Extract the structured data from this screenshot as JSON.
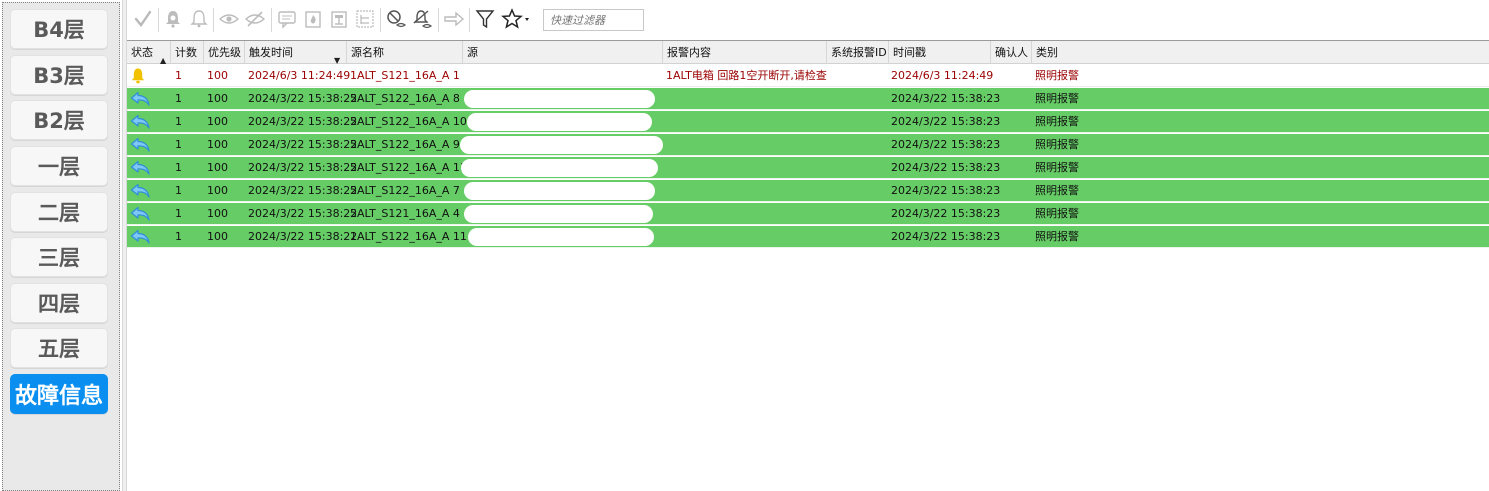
{
  "sidebar": {
    "items": [
      {
        "label": "B4层",
        "active": false
      },
      {
        "label": "B3层",
        "active": false
      },
      {
        "label": "B2层",
        "active": false
      },
      {
        "label": "一层",
        "active": false
      },
      {
        "label": "二层",
        "active": false
      },
      {
        "label": "三层",
        "active": false
      },
      {
        "label": "四层",
        "active": false
      },
      {
        "label": "五层",
        "active": false
      },
      {
        "label": "故障信息",
        "active": true
      }
    ]
  },
  "toolbar": {
    "icons": [
      "acknowledge-check-icon",
      "bell-icon",
      "bell-outline-icon",
      "eye-icon",
      "eye-slash-icon",
      "comment-icon",
      "fire-icon",
      "list-box-icon",
      "tree-icon",
      "silence-icon",
      "bell-slash-icon",
      "arrow-right-icon",
      "filter-funnel-icon",
      "star-dropdown-icon"
    ],
    "quick_filter_placeholder": "快速过滤器"
  },
  "table": {
    "columns": [
      "状态",
      "计数",
      "优先级",
      "触发时间",
      "源名称",
      "源",
      "报警内容",
      "系统报警ID",
      "时间戳",
      "确认人",
      "类别"
    ],
    "rows": [
      {
        "state": "active",
        "status_icon": "bell-icon",
        "count": "1",
        "priority": "100",
        "trigger_time": "2024/6/3 11:24:49",
        "source_name": "1ALT_S121_16A_A 1",
        "content": "1ALT电箱 回路1空开断开,请检查",
        "sys_id": "",
        "timestamp": "2024/6/3 11:24:49",
        "ack_by": "",
        "category": "照明报警"
      },
      {
        "state": "ack",
        "status_icon": "return-arrow-icon",
        "count": "1",
        "priority": "100",
        "trigger_time": "2024/3/22 15:38:22",
        "source_name": "5ALT_S122_16A_A 8",
        "content": "",
        "sys_id": "",
        "timestamp": "2024/3/22 15:38:23",
        "ack_by": "",
        "category": "照明报警"
      },
      {
        "state": "ack",
        "status_icon": "return-arrow-icon",
        "count": "1",
        "priority": "100",
        "trigger_time": "2024/3/22 15:38:22",
        "source_name": "5ALT_S122_16A_A 10",
        "content": "",
        "sys_id": "",
        "timestamp": "2024/3/22 15:38:23",
        "ack_by": "",
        "category": "照明报警"
      },
      {
        "state": "ack",
        "status_icon": "return-arrow-icon",
        "count": "1",
        "priority": "100",
        "trigger_time": "2024/3/22 15:38:22",
        "source_name": "5ALT_S122_16A_A 9",
        "content": "",
        "sys_id": "",
        "timestamp": "2024/3/22 15:38:23",
        "ack_by": "",
        "category": "照明报警"
      },
      {
        "state": "ack",
        "status_icon": "return-arrow-icon",
        "count": "1",
        "priority": "100",
        "trigger_time": "2024/3/22 15:38:22",
        "source_name": "5ALT_S122_16A_A 11",
        "content": "",
        "sys_id": "",
        "timestamp": "2024/3/22 15:38:23",
        "ack_by": "",
        "category": "照明报警"
      },
      {
        "state": "ack",
        "status_icon": "return-arrow-icon",
        "count": "1",
        "priority": "100",
        "trigger_time": "2024/3/22 15:38:22",
        "source_name": "5ALT_S122_16A_A 7",
        "content": "",
        "sys_id": "",
        "timestamp": "2024/3/22 15:38:23",
        "ack_by": "",
        "category": "照明报警"
      },
      {
        "state": "ack",
        "status_icon": "return-arrow-icon",
        "count": "1",
        "priority": "100",
        "trigger_time": "2024/3/22 15:38:22",
        "source_name": "5ALT_S121_16A_A 4",
        "content": "",
        "sys_id": "",
        "timestamp": "2024/3/22 15:38:23",
        "ack_by": "",
        "category": "照明报警"
      },
      {
        "state": "ack",
        "status_icon": "return-arrow-icon",
        "count": "1",
        "priority": "100",
        "trigger_time": "2024/3/22 15:38:22",
        "source_name": "1ALT_S122_16A_A 11",
        "content": "",
        "sys_id": "",
        "timestamp": "2024/3/22 15:38:23",
        "ack_by": "",
        "category": "照明报警"
      }
    ]
  },
  "colors": {
    "acknowledged_row": "#66cc66",
    "active_alarm_text": "#9b0000",
    "active_sidebar": "#0a8ff0",
    "bell": "#f2c200",
    "return_arrow": "#3aa0e6"
  }
}
